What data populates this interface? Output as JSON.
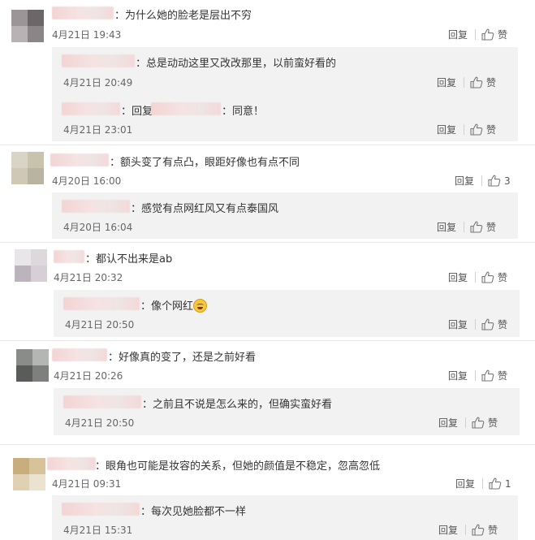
{
  "colors": {
    "accent_blue": "#eb7350",
    "divider": "#e6e6e6",
    "sub_bg": "#f2f2f2",
    "text": "#333333",
    "muted": "#666666"
  },
  "labels": {
    "reply": "回复",
    "like": "赞"
  },
  "comments": [
    {
      "text": "：为什么她的脸老是层出不穷",
      "time": "4月21日 19:43",
      "like": "赞",
      "replies": [
        {
          "text": "：总是动动这里又改改那里，以前蛮好看的",
          "time": "4月21日 20:49",
          "like": "赞"
        },
        {
          "prefix": "：回复",
          "text": "：同意！",
          "time": "4月21日 23:01",
          "like": "赞"
        }
      ]
    },
    {
      "text": "：额头变了有点凸，眼距好像也有点不同",
      "time": "4月20日 16:00",
      "like": "3",
      "replies": [
        {
          "text": "：感觉有点网红风又有点泰国风",
          "time": "4月20日 16:04",
          "like": "赞"
        }
      ]
    },
    {
      "text": "：都认不出来是ab",
      "time": "4月21日 20:32",
      "like": "赞",
      "replies": [
        {
          "text": "：像个网红",
          "time": "4月21日 20:50",
          "like": "赞"
        }
      ]
    },
    {
      "text": "：好像真的变了，还是之前好看",
      "time": "4月21日 20:26",
      "like": "赞",
      "replies": [
        {
          "text": "：之前且不说是怎么来的，但确实蛮好看",
          "time": "4月21日 20:50",
          "like": "赞"
        }
      ]
    },
    {
      "text": "：眼角也可能是妆容的关系，但她的颜值是不稳定，忽高忽低",
      "time": "4月21日 09:31",
      "like": "1",
      "replies": [
        {
          "text": "：每次见她脸都不一样",
          "time": "4月21日 15:31",
          "like": "赞"
        }
      ]
    }
  ]
}
